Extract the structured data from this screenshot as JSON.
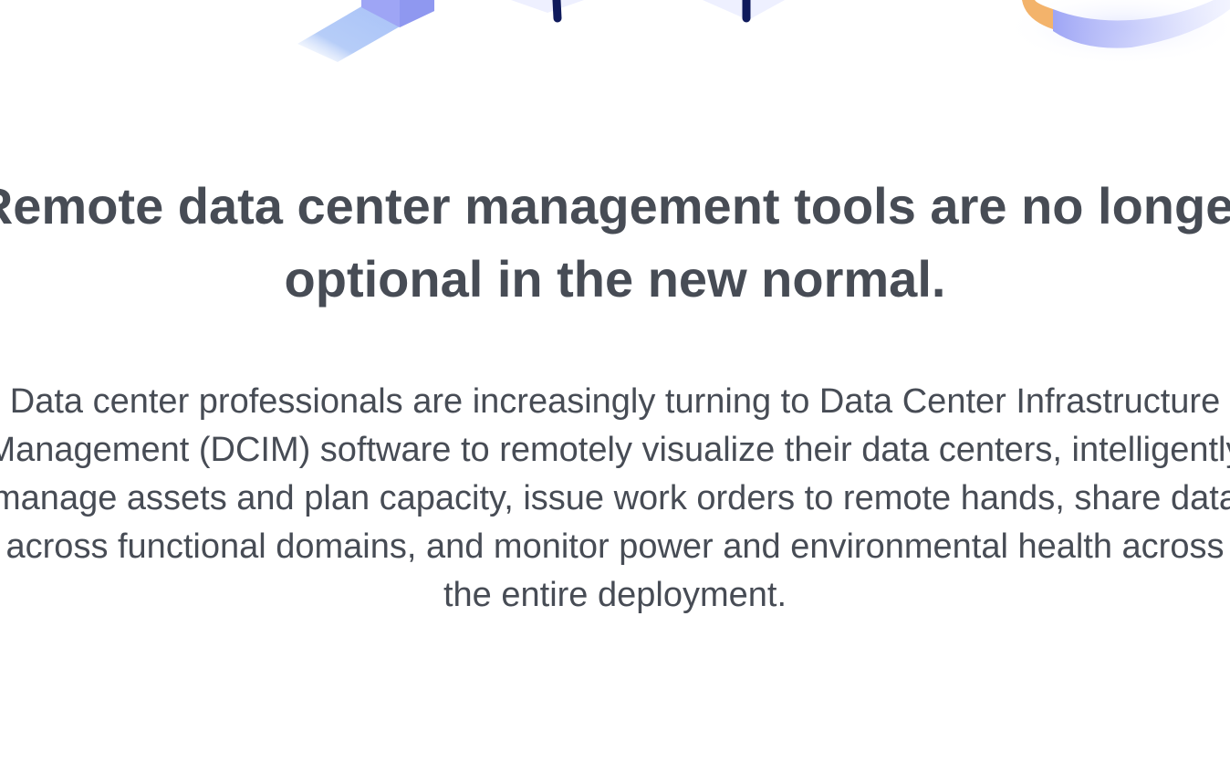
{
  "hero": {
    "headline_lines": [
      "Remote data center management tools are no longer",
      "optional in the new normal."
    ],
    "body_lines": [
      "Data center professionals are increasingly turning to Data Center Infrastructure",
      "Management (DCIM) software to remotely visualize their data centers, intelligently",
      "manage assets and plan capacity, issue work orders to remote hands, share data",
      "across functional domains, and monitor power and environmental health across",
      "the entire deployment."
    ]
  },
  "illustration": {
    "icons": [
      "server-block-icon",
      "cable-icon",
      "cable-icon",
      "pie-chart-icon"
    ],
    "colors": {
      "light_blue": "#b6cdf8",
      "periwinkle": "#9ea5f5",
      "navy": "#0f1a5c",
      "lavender": "#e8ebff",
      "orange": "#f3b36b"
    }
  }
}
